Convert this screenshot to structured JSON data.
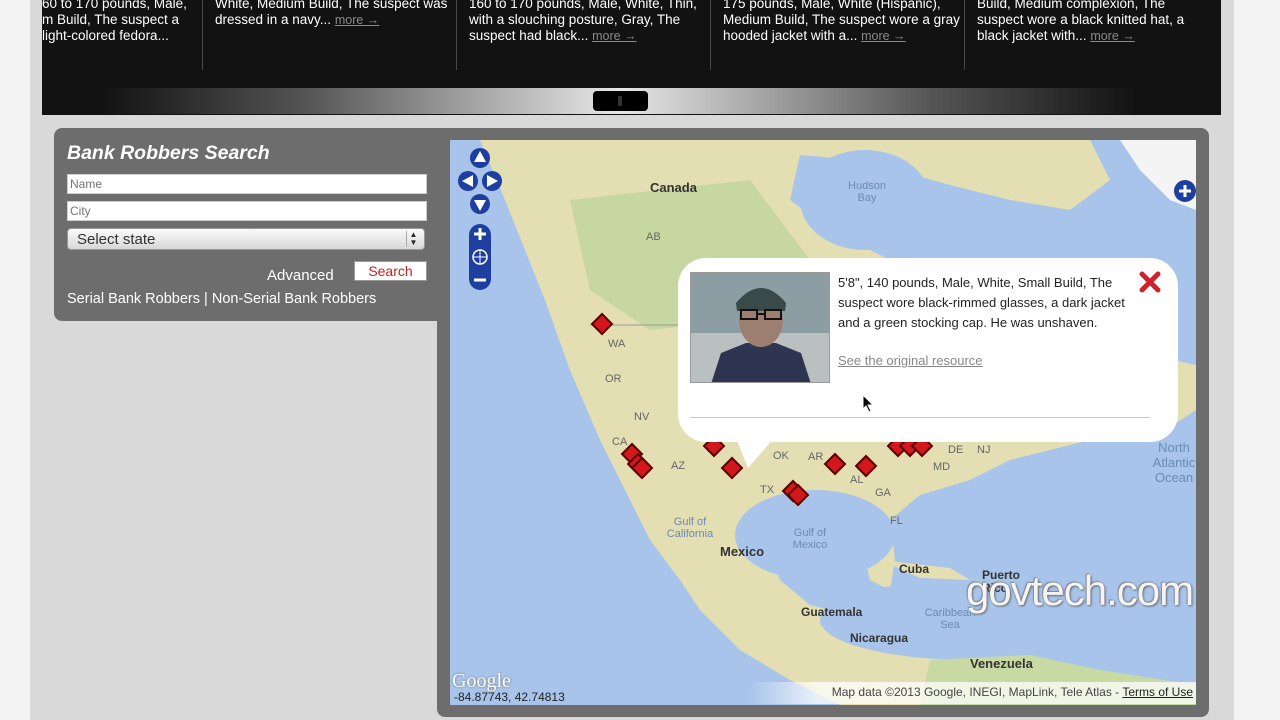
{
  "carousel": {
    "cards": [
      {
        "text": "60 to 170 pounds, Male, m Build, The suspect a light-colored fedora...",
        "more": ""
      },
      {
        "text": "White, Medium Build, The suspect was dressed in a navy...",
        "more": "more →"
      },
      {
        "text": "160 to 170 pounds, Male, White, Thin, with a slouching posture, Gray, The suspect had black...",
        "more": "more →"
      },
      {
        "text": "175 pounds, Male, White (Hispanic), Medium Build, The suspect wore a gray hooded jacket with a...",
        "more": "more →"
      },
      {
        "text": "Build, Medium complexion, The suspect wore a black knitted hat, a black jacket with...",
        "more": "more →"
      }
    ]
  },
  "search": {
    "title": "Bank Robbers Search",
    "name_placeholder": "Name",
    "city_placeholder": "City",
    "state_select": "Select state",
    "advanced": "Advanced",
    "search_button": "Search",
    "serial_link": "Serial Bank Robbers",
    "separator": "|",
    "non_serial_link": "Non-Serial Bank Robbers"
  },
  "map": {
    "places": {
      "canada": "Canada",
      "hudson_bay": "Hudson Bay",
      "ab": "AB",
      "wa": "WA",
      "or": "OR",
      "nv": "NV",
      "ca": "CA",
      "az": "AZ",
      "tx": "TX",
      "ok": "OK",
      "ar": "AR",
      "al": "AL",
      "ga": "GA",
      "fl": "FL",
      "de": "DE",
      "nj": "NJ",
      "md": "MD",
      "gulf_california": "Gulf of California",
      "gulf_mexico": "Gulf of Mexico",
      "mexico": "Mexico",
      "cuba": "Cuba",
      "puerto_rico": "Puerto Rico",
      "guatemala": "Guatemala",
      "nicaragua": "Nicaragua",
      "caribbean": "Caribbean Sea",
      "venezuela": "Venezuela",
      "north_atlantic": "North Atlantic Ocean"
    },
    "popup": {
      "description": "5'8\", 140 pounds, Male, White, Small Build, The suspect wore black-rimmed glasses, a dark jacket and a green stocking cap. He was unshaven.",
      "link": "See the original resource"
    },
    "google_logo": "Google",
    "coordinates": "-84.87743, 42.74813",
    "attribution": "Map data ©2013 Google, INEGI, MapLink, Tele Atlas -",
    "terms": "Terms of Use",
    "colors": {
      "marker": "#d3181b",
      "land": "#e3dfb2",
      "water": "#a9c4ea"
    }
  },
  "watermark": "govtech.com"
}
